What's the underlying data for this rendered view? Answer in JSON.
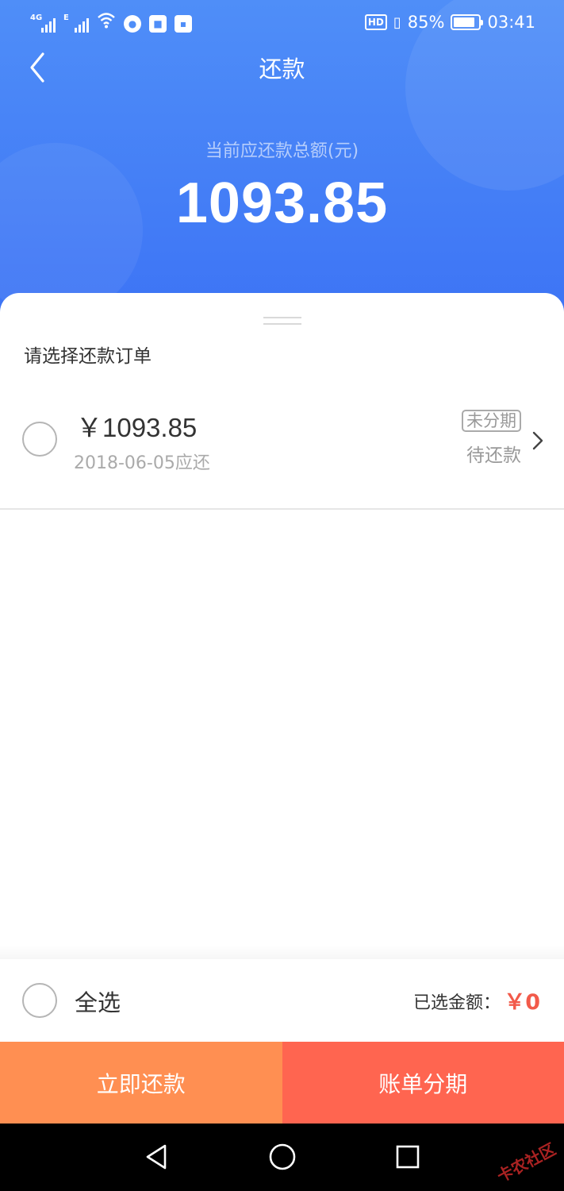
{
  "status_bar": {
    "network1": "4G",
    "network2": "E",
    "hd": "HD",
    "battery_percent": "85%",
    "battery_level": 0.85,
    "time": "03:41"
  },
  "header": {
    "title": "还款",
    "total_label": "当前应还款总额(元)",
    "total_amount": "1093.85"
  },
  "section_title": "请选择还款订单",
  "orders": [
    {
      "amount": "￥1093.85",
      "due_date": "2018-06-05应还",
      "tag": "未分期",
      "status": "待还款"
    }
  ],
  "footer": {
    "select_all": "全选",
    "selected_label": "已选金额：",
    "selected_value": "￥0"
  },
  "actions": {
    "pay_now": "立即还款",
    "installment": "账单分期"
  },
  "watermark": "卡农社区",
  "colors": {
    "header_blue": "#4f8ef8",
    "pay_orange": "#ff8f52",
    "installment_red": "#ff6550",
    "amount_red": "#f25a4a"
  },
  "icons": {
    "back": "chevron-left-icon",
    "row_chevron": "chevron-right-icon",
    "nav_back": "triangle-back-icon",
    "nav_home": "circle-home-icon",
    "nav_recent": "square-recent-icon"
  }
}
